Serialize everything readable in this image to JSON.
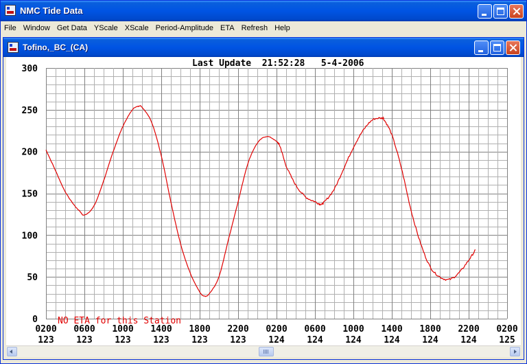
{
  "app": {
    "title": "NMC Tide Data",
    "menu": [
      "File",
      "Window",
      "Get Data",
      "YScale",
      "XScale",
      "Period-Amplitude",
      "ETA",
      "Refresh",
      "Help"
    ]
  },
  "child": {
    "title": "Tofino,_BC_(CA)"
  },
  "plot": {
    "last_update": "Last Update  21:52:28   5-4-2006",
    "note": "NO ETA for this Station"
  },
  "colors": {
    "curve": "#e00000",
    "grid": "#b0b0b0",
    "grid_major": "#808080",
    "note": "#e00000"
  },
  "chart_data": {
    "type": "line",
    "ylim": [
      0,
      300
    ],
    "y_ticks": [
      "0",
      "50",
      "100",
      "150",
      "200",
      "250",
      "300"
    ],
    "x_ticks": [
      {
        "time": "0200",
        "day": "123"
      },
      {
        "time": "0600",
        "day": "123"
      },
      {
        "time": "1000",
        "day": "123"
      },
      {
        "time": "1400",
        "day": "123"
      },
      {
        "time": "1800",
        "day": "123"
      },
      {
        "time": "2200",
        "day": "123"
      },
      {
        "time": "0200",
        "day": "124"
      },
      {
        "time": "0600",
        "day": "124"
      },
      {
        "time": "1000",
        "day": "124"
      },
      {
        "time": "1400",
        "day": "124"
      },
      {
        "time": "1800",
        "day": "124"
      },
      {
        "time": "2200",
        "day": "124"
      },
      {
        "time": "0200",
        "day": "125"
      }
    ],
    "x_unit": "hours",
    "grid": true,
    "series": [
      {
        "x": [
          2,
          3,
          4,
          5,
          5.5,
          6,
          7,
          8,
          9,
          10,
          11,
          11.6,
          12,
          13,
          14,
          15,
          16,
          17,
          18,
          18.5,
          19,
          20,
          21,
          22,
          23,
          24,
          25,
          26,
          26.4,
          27,
          28,
          29,
          30,
          30.6,
          31,
          32,
          33,
          34,
          35,
          36,
          37,
          37.2,
          38,
          39,
          40,
          41,
          42,
          43,
          44,
          45,
          46,
          46.7
        ],
        "y": [
          202,
          177,
          152,
          135,
          129,
          124,
          135,
          165,
          200,
          230,
          250,
          254,
          253,
          235,
          195,
          140,
          90,
          55,
          32,
          27,
          30,
          50,
          95,
          140,
          185,
          210,
          218,
          212,
          205,
          183,
          160,
          146,
          140,
          137,
          140,
          155,
          180,
          205,
          225,
          238,
          240,
          238,
          220,
          180,
          130,
          90,
          62,
          50,
          47,
          55,
          70,
          82
        ]
      }
    ]
  }
}
